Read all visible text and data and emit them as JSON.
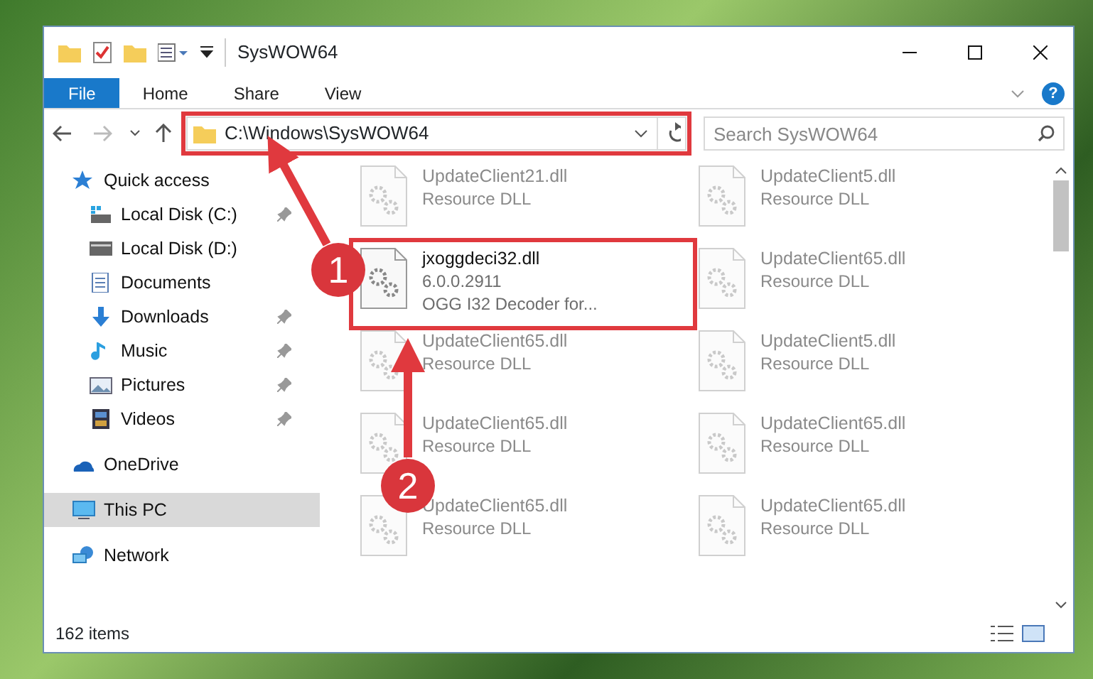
{
  "window": {
    "title": "SysWOW64"
  },
  "ribbon": {
    "tabs": [
      {
        "label": "File",
        "selected": true
      },
      {
        "label": "Home",
        "selected": false
      },
      {
        "label": "Share",
        "selected": false
      },
      {
        "label": "View",
        "selected": false
      }
    ],
    "help": "?"
  },
  "address_bar": {
    "path": "C:\\Windows\\SysWOW64",
    "highlighted": true
  },
  "search": {
    "placeholder": "Search SysWOW64"
  },
  "sidebar": {
    "items": [
      {
        "label": "Quick access",
        "kind": "star",
        "selected": false,
        "children": [
          {
            "label": "Local Disk (C:)",
            "kind": "systemdrive",
            "pinned": true,
            "selected": false
          },
          {
            "label": "Local Disk (D:)",
            "kind": "drive",
            "pinned": false,
            "selected": false
          },
          {
            "label": "Documents",
            "kind": "documents",
            "pinned": false,
            "selected": false
          },
          {
            "label": "Downloads",
            "kind": "downloads",
            "pinned": true,
            "selected": false
          },
          {
            "label": "Music",
            "kind": "music",
            "pinned": true,
            "selected": false
          },
          {
            "label": "Pictures",
            "kind": "pictures",
            "pinned": true,
            "selected": false
          },
          {
            "label": "Videos",
            "kind": "videos",
            "pinned": true,
            "selected": false
          }
        ]
      },
      {
        "label": "OneDrive",
        "kind": "cloud",
        "selected": false
      },
      {
        "label": "This PC",
        "kind": "pc",
        "selected": true
      },
      {
        "label": "Network",
        "kind": "network",
        "selected": false
      }
    ]
  },
  "files": [
    {
      "name": "UpdateClient21.dll",
      "lines": [
        "Resource DLL"
      ],
      "blurred": true,
      "highlighted": false
    },
    {
      "name": "UpdateClient5.dll",
      "lines": [
        "Resource DLL"
      ],
      "blurred": true,
      "highlighted": false
    },
    {
      "name": "jxoggdeci32.dll",
      "lines": [
        "6.0.0.2911",
        "OGG I32 Decoder for..."
      ],
      "blurred": false,
      "highlighted": true
    },
    {
      "name": "UpdateClient65.dll",
      "lines": [
        "Resource DLL"
      ],
      "blurred": true,
      "highlighted": false
    },
    {
      "name": "UpdateClient65.dll",
      "lines": [
        "Resource DLL"
      ],
      "blurred": true,
      "highlighted": false
    },
    {
      "name": "UpdateClient5.dll",
      "lines": [
        "Resource DLL"
      ],
      "blurred": true,
      "highlighted": false
    },
    {
      "name": "UpdateClient65.dll",
      "lines": [
        "Resource DLL"
      ],
      "blurred": true,
      "highlighted": false
    },
    {
      "name": "UpdateClient65.dll",
      "lines": [
        "Resource DLL"
      ],
      "blurred": true,
      "highlighted": false
    },
    {
      "name": "UpdateClient65.dll",
      "lines": [
        "Resource DLL"
      ],
      "blurred": true,
      "highlighted": false
    },
    {
      "name": "UpdateClient65.dll",
      "lines": [
        "Resource DLL"
      ],
      "blurred": true,
      "highlighted": false
    }
  ],
  "status_bar": {
    "count": "162 items"
  },
  "annotations": [
    {
      "label": "1"
    },
    {
      "label": "2"
    }
  ]
}
